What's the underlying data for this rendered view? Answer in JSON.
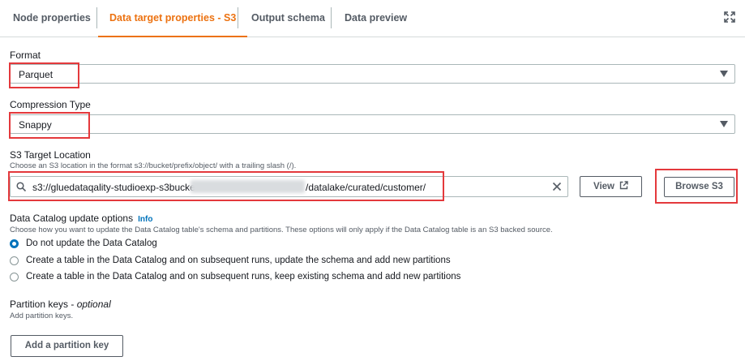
{
  "tabs": [
    {
      "label": "Node properties",
      "active": false
    },
    {
      "label": "Data target properties - S3",
      "active": true
    },
    {
      "label": "Output schema",
      "active": false
    },
    {
      "label": "Data preview",
      "active": false
    }
  ],
  "format": {
    "label": "Format",
    "value": "Parquet"
  },
  "compression": {
    "label": "Compression Type",
    "value": "Snappy"
  },
  "s3_target": {
    "label": "S3 Target Location",
    "hint": "Choose an S3 location in the format s3://bucket/prefix/object/ with a trailing slash (/).",
    "value_prefix": "s3://gluedataqality-studioexp-s3bucke",
    "value_suffix": "/datalake/curated/customer/",
    "view_label": "View",
    "browse_label": "Browse S3"
  },
  "catalog": {
    "label": "Data Catalog update options",
    "info_label": "Info",
    "hint": "Choose how you want to update the Data Catalog table's schema and partitions. These options will only apply if the Data Catalog table is an S3 backed source.",
    "options": [
      {
        "label": "Do not update the Data Catalog",
        "checked": true
      },
      {
        "label": "Create a table in the Data Catalog and on subsequent runs, update the schema and add new partitions",
        "checked": false
      },
      {
        "label": "Create a table in the Data Catalog and on subsequent runs, keep existing schema and add new partitions",
        "checked": false
      }
    ]
  },
  "partition": {
    "label": "Partition keys - ",
    "label_optional": "optional",
    "hint": "Add partition keys.",
    "add_label": "Add a partition key"
  },
  "colors": {
    "accent": "#ec7211",
    "link": "#0073bb",
    "highlight": "#e4393c"
  },
  "icons": [
    "expand-icon",
    "caret-down-icon",
    "search-icon",
    "clear-icon",
    "external-link-icon"
  ]
}
